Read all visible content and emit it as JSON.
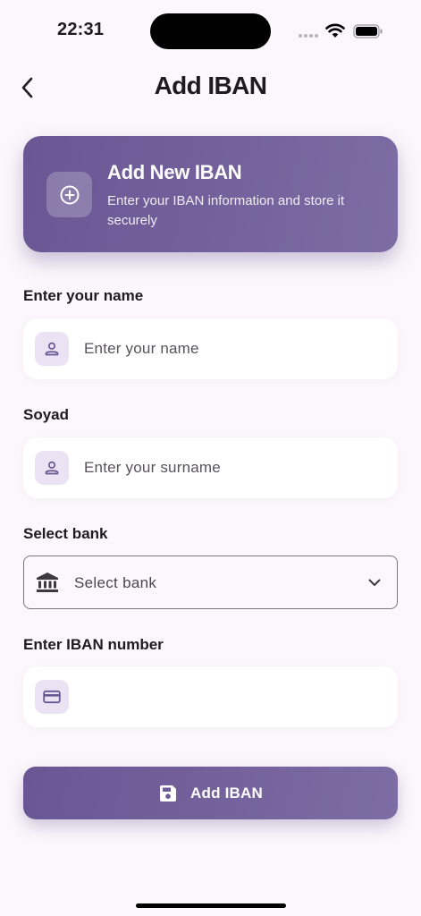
{
  "status_bar": {
    "time": "22:31"
  },
  "header": {
    "title": "Add IBAN"
  },
  "banner": {
    "title": "Add New IBAN",
    "subtitle": "Enter your IBAN information and store it securely",
    "icon": "plus-circle-icon"
  },
  "form": {
    "name": {
      "label": "Enter your name",
      "placeholder": "Enter your name",
      "value": "",
      "icon": "person-icon"
    },
    "surname": {
      "label": "Soyad",
      "placeholder": "Enter your surname",
      "value": "",
      "icon": "person-icon"
    },
    "bank": {
      "label": "Select bank",
      "selected": "Select bank",
      "icon": "bank-icon"
    },
    "iban": {
      "label": "Enter IBAN number",
      "placeholder": "",
      "value": "",
      "icon": "card-icon"
    }
  },
  "submit": {
    "label": "Add IBAN",
    "icon": "save-icon"
  },
  "colors": {
    "background": "#fcf7fc",
    "accent": "#6a5693",
    "accent_light": "#ebe3f3"
  }
}
